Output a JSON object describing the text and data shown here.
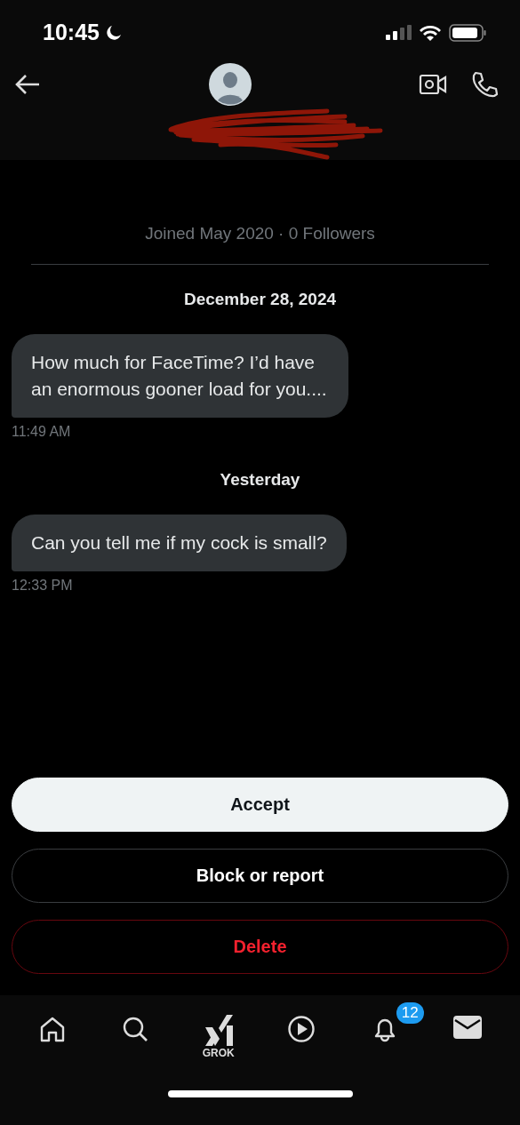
{
  "status_bar": {
    "time": "10:45"
  },
  "conversation": {
    "joined": "Joined May 2020 · 0 Followers"
  },
  "messages": [
    {
      "kind": "date",
      "text": "December 28, 2024"
    },
    {
      "kind": "bubble",
      "text": "How much for FaceTime?  I’d have an enormous gooner load for you....",
      "time": "11:49 AM"
    },
    {
      "kind": "date",
      "text": "Yesterday"
    },
    {
      "kind": "bubble",
      "text": "Can you tell me if my cock is small?",
      "time": "12:33 PM"
    }
  ],
  "actions": [
    {
      "kind": "primary",
      "label": "Accept"
    },
    {
      "kind": "outline",
      "label": "Block or report"
    },
    {
      "kind": "danger",
      "label": "Delete"
    }
  ],
  "tab_bar": [
    {
      "kind": "home",
      "selected": false
    },
    {
      "kind": "search",
      "selected": false
    },
    {
      "kind": "grok",
      "label": "GROK",
      "selected": false
    },
    {
      "kind": "play",
      "selected": false
    },
    {
      "kind": "bell",
      "badge": "12",
      "selected": false
    },
    {
      "kind": "mail",
      "selected": true
    }
  ]
}
